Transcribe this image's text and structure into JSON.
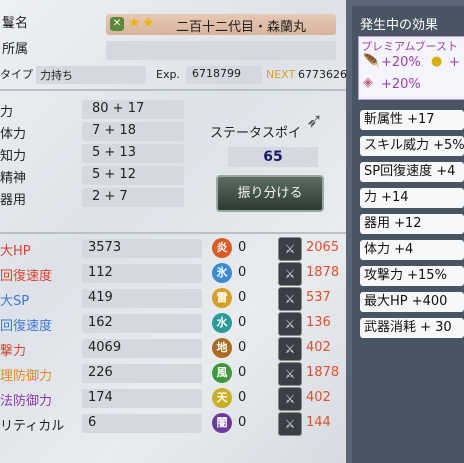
{
  "header": {
    "name_label": "鬘名",
    "name_value": "二百十二代目・森蘭丸",
    "affiliation_label": "所属",
    "type_label": "タイプ",
    "type_value": "力持ち",
    "exp_label": "Exp.",
    "exp_value": "6718799",
    "next_label": "NEXT",
    "next_value": "6773626"
  },
  "stats": [
    {
      "label": "力",
      "value": "80 + 17"
    },
    {
      "label": "体力",
      "value": "7 + 18"
    },
    {
      "label": "知力",
      "value": "5 + 13"
    },
    {
      "label": "精神",
      "value": "5 + 12"
    },
    {
      "label": "器用",
      "value": "2 + 7"
    }
  ],
  "status_points": {
    "label": "ステータスポイ",
    "value": "65",
    "button": "振り分ける"
  },
  "derived": [
    {
      "label": "大HP",
      "value": "3573",
      "color": "#e0402a"
    },
    {
      "label": "回復速度",
      "value": "112",
      "color": "#e0402a"
    },
    {
      "label": "大SP",
      "value": "419",
      "color": "#3a78d6"
    },
    {
      "label": "回復速度",
      "value": "162",
      "color": "#3a78d6"
    },
    {
      "label": "撃力",
      "value": "4069",
      "color": "#e0402a"
    },
    {
      "label": "理防御力",
      "value": "226",
      "color": "#e08a20"
    },
    {
      "label": "法防御力",
      "value": "174",
      "color": "#8a3ab0"
    },
    {
      "label": "リティカル",
      "value": "6",
      "color": "#222222"
    }
  ],
  "elements": [
    {
      "icon": "fire-icon",
      "glyph": "炎",
      "bg": "#e05a20",
      "value": "0"
    },
    {
      "icon": "ice-icon",
      "glyph": "氷",
      "bg": "#3a8ad8",
      "value": "0"
    },
    {
      "icon": "lightning-icon",
      "glyph": "雷",
      "bg": "#d8a020",
      "value": "0"
    },
    {
      "icon": "water-icon",
      "glyph": "水",
      "bg": "#2a9a9a",
      "value": "0"
    },
    {
      "icon": "earth-icon",
      "glyph": "地",
      "bg": "#b06a20",
      "value": "0"
    },
    {
      "icon": "wind-icon",
      "glyph": "風",
      "bg": "#3a9a3a",
      "value": "0"
    },
    {
      "icon": "heaven-icon",
      "glyph": "天",
      "bg": "#c8b020",
      "value": "0"
    },
    {
      "icon": "dark-icon",
      "glyph": "闇",
      "bg": "#6a3aa0",
      "value": "0"
    }
  ],
  "weapons": [
    {
      "icon": "sword-icon",
      "value": "2065"
    },
    {
      "icon": "katana-icon",
      "value": "1878"
    },
    {
      "icon": "spear-icon",
      "value": "537"
    },
    {
      "icon": "staff-icon",
      "value": "136"
    },
    {
      "icon": "axe-icon",
      "value": "402"
    },
    {
      "icon": "fan-icon",
      "value": "1878"
    },
    {
      "icon": "bow-icon",
      "value": "402"
    },
    {
      "icon": "dagger-icon",
      "value": "144"
    }
  ],
  "effects_panel": {
    "title": "発生中の効果",
    "premium_label": "プレミアムブースト",
    "premium_1": "+20%",
    "premium_2": "+",
    "premium_3": "+20%",
    "effects": [
      "斬属性 +17",
      "スキル威力 +5%",
      "SP回復速度 +4",
      "力 +14",
      "器用 +12",
      "体力 +4",
      "攻撃力 +15%",
      "最大HP +400",
      "武器消耗 + 30"
    ]
  }
}
